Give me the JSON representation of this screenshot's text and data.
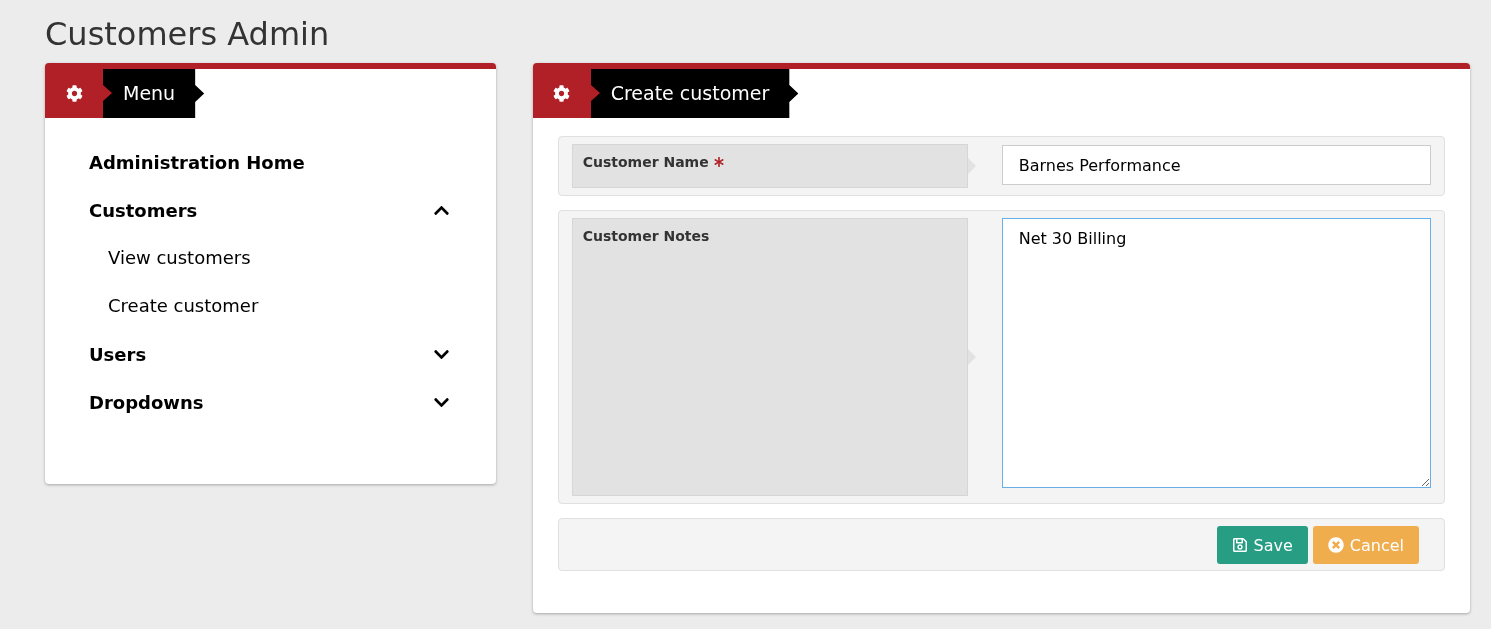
{
  "page_title": "Customers Admin",
  "menu": {
    "title": "Menu",
    "items": [
      {
        "label": "Administration Home"
      },
      {
        "label": "Customers",
        "expanded": true,
        "children": [
          {
            "label": "View customers"
          },
          {
            "label": "Create customer"
          }
        ]
      },
      {
        "label": "Users",
        "expanded": false
      },
      {
        "label": "Dropdowns",
        "expanded": false
      }
    ]
  },
  "form": {
    "title": "Create customer",
    "fields": [
      {
        "kind": "text",
        "label": "Customer Name",
        "required": true,
        "value": "Barnes Performance",
        "focused": false
      },
      {
        "kind": "textarea",
        "label": "Customer Notes",
        "required": false,
        "value": "Net 30 Billing",
        "focused": true
      }
    ],
    "buttons": [
      {
        "kind": "save",
        "label": "Save"
      },
      {
        "kind": "cancel",
        "label": "Cancel"
      }
    ]
  }
}
